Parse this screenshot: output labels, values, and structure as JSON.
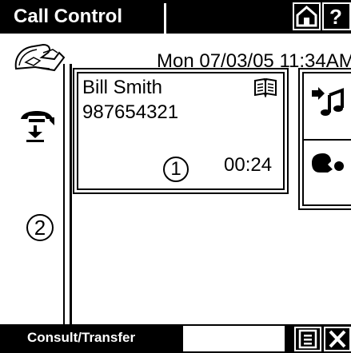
{
  "header": {
    "title": "Call Control",
    "home_icon": "home-icon",
    "help_label": "?"
  },
  "status": {
    "datetime": "Mon 07/03/05 11:34AM"
  },
  "call": {
    "caller_name": "Bill Smith",
    "caller_number": "987654321",
    "index": "1",
    "timer": "00:24",
    "contact_icon": "address-book-icon"
  },
  "left_column": {
    "phone_icon": "handset-icon",
    "hold_icon": "hold-icon",
    "transfer_icon": "transfer-icon",
    "line_index": "2"
  },
  "tools": {
    "music_icon": "music-transfer-icon",
    "conference_icon": "conference-icon"
  },
  "softkeys": {
    "label": "Consult/Transfer",
    "list_icon": "list-icon",
    "close_icon": "close-icon"
  }
}
